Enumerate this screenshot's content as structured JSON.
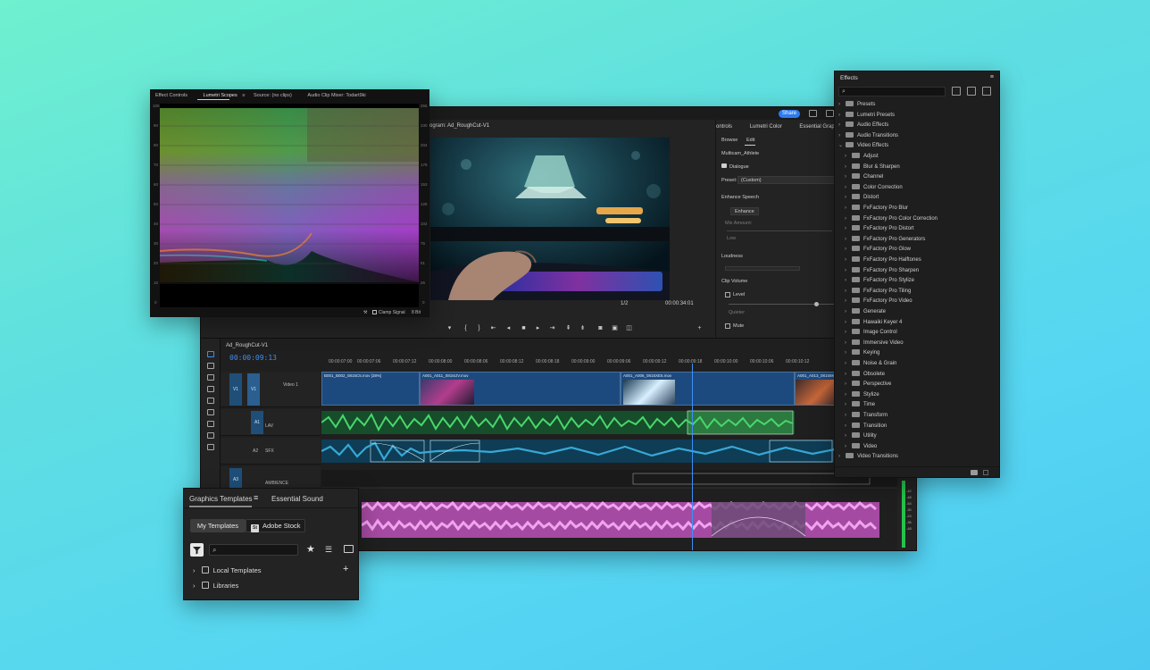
{
  "main": {
    "share_label": "Share",
    "program_tab": "Program: Ad_RoughCut-V1",
    "monitor_zoom": "1/2",
    "monitor_timecode": "00:00:34:01",
    "essential_sound": {
      "tabs": [
        "ontrols",
        "Lumetri Color",
        "Essential Graphics"
      ],
      "browse": "Browse",
      "edit": "Edit",
      "clip_name": "Multicam_Athlete",
      "type": "Dialogue",
      "preset_label": "Preset:",
      "preset_value": "(Custom)",
      "enhance_speech": "Enhance Speech",
      "enhance_button": "Enhance",
      "mix_amount": "Mix Amount:",
      "low": "Low",
      "loudness": "Loudness",
      "clip_volume": "Clip Volume",
      "level": "Level",
      "quieter": "Quieter",
      "mute": "Mute"
    }
  },
  "timeline": {
    "sequence_tab": "Ad_RoughCut-V1",
    "timecode": "00:00:09:13",
    "ruler": [
      "00:00:07:00",
      "00:00:07:06",
      "00:00:07:12",
      "00:00:08:00",
      "00:00:08:06",
      "00:00:08:12",
      "00:00:08:18",
      "00:00:09:00",
      "00:00:09:06",
      "00:00:09:12",
      "00:00:09:18",
      "00:00:10:00",
      "00:00:10:06",
      "00:00:10:12"
    ],
    "tracks": {
      "v1": {
        "badge": "V1",
        "target": "V1",
        "name": "Video 1"
      },
      "a1": {
        "badge": "A1",
        "name": "LAV"
      },
      "a2": {
        "badge": "A2",
        "name": "SFX"
      },
      "a3": {
        "badge": "A3",
        "name": "AMBIENCE"
      }
    },
    "clips": {
      "v1": [
        "B001_B002_0815C5.mov [38%]",
        "A001_A011_0815IJV.mov",
        "A001_A006_0815XE5.mov",
        "A001_A013_08158K.m"
      ]
    },
    "meter_ticks": [
      "-42",
      "-48",
      "-54",
      "-30",
      "-24",
      "-36",
      "-48"
    ]
  },
  "scopes": {
    "tabs": [
      "Effect Controls",
      "Lumetri Scopes",
      "Source: (no clips)",
      "Audio Clip Mixer: Todart9ki"
    ],
    "left_ticks": [
      "100",
      "90",
      "80",
      "70",
      "60",
      "50",
      "40",
      "30",
      "20",
      "10",
      "0"
    ],
    "right_ticks": [
      "255",
      "230",
      "204",
      "178",
      "153",
      "128",
      "102",
      "76",
      "51",
      "26",
      "0"
    ],
    "clamp_signal": "Clamp Signal",
    "bit_depth": "8 Bit"
  },
  "effects": {
    "title": "Effects",
    "items": [
      {
        "label": "Presets",
        "level": 0,
        "open": false
      },
      {
        "label": "Lumetri Presets",
        "level": 0,
        "open": false
      },
      {
        "label": "Audio Effects",
        "level": 0,
        "open": false
      },
      {
        "label": "Audio Transitions",
        "level": 0,
        "open": false
      },
      {
        "label": "Video Effects",
        "level": 0,
        "open": true
      },
      {
        "label": "Adjust",
        "level": 1,
        "open": false
      },
      {
        "label": "Blur & Sharpen",
        "level": 1,
        "open": false
      },
      {
        "label": "Channel",
        "level": 1,
        "open": false
      },
      {
        "label": "Color Correction",
        "level": 1,
        "open": false
      },
      {
        "label": "Distort",
        "level": 1,
        "open": false
      },
      {
        "label": "FxFactory Pro Blur",
        "level": 1,
        "open": false
      },
      {
        "label": "FxFactory Pro Color Correction",
        "level": 1,
        "open": false
      },
      {
        "label": "FxFactory Pro Distort",
        "level": 1,
        "open": false
      },
      {
        "label": "FxFactory Pro Generators",
        "level": 1,
        "open": false
      },
      {
        "label": "FxFactory Pro Glow",
        "level": 1,
        "open": false
      },
      {
        "label": "FxFactory Pro Halftones",
        "level": 1,
        "open": false
      },
      {
        "label": "FxFactory Pro Sharpen",
        "level": 1,
        "open": false
      },
      {
        "label": "FxFactory Pro Stylize",
        "level": 1,
        "open": false
      },
      {
        "label": "FxFactory Pro Tiling",
        "level": 1,
        "open": false
      },
      {
        "label": "FxFactory Pro Video",
        "level": 1,
        "open": false
      },
      {
        "label": "Generate",
        "level": 1,
        "open": false
      },
      {
        "label": "Hawaiki Keyer 4",
        "level": 1,
        "open": false
      },
      {
        "label": "Image Control",
        "level": 1,
        "open": false
      },
      {
        "label": "Immersive Video",
        "level": 1,
        "open": false
      },
      {
        "label": "Keying",
        "level": 1,
        "open": false
      },
      {
        "label": "Noise & Grain",
        "level": 1,
        "open": false
      },
      {
        "label": "Obsolete",
        "level": 1,
        "open": false
      },
      {
        "label": "Perspective",
        "level": 1,
        "open": false
      },
      {
        "label": "Stylize",
        "level": 1,
        "open": false
      },
      {
        "label": "Time",
        "level": 1,
        "open": false
      },
      {
        "label": "Transform",
        "level": 1,
        "open": false
      },
      {
        "label": "Transition",
        "level": 1,
        "open": false
      },
      {
        "label": "Utility",
        "level": 1,
        "open": false
      },
      {
        "label": "Video",
        "level": 1,
        "open": false
      },
      {
        "label": "Video Transitions",
        "level": 0,
        "open": false
      }
    ]
  },
  "graphics_templates": {
    "tab_active": "Graphics Templates",
    "tab_other": "Essential Sound",
    "my_templates": "My Templates",
    "stock_badge": "St",
    "adobe_stock": "Adobe Stock",
    "rows": [
      "Local Templates",
      "Libraries"
    ]
  },
  "colors": {
    "accent": "#2d7cf0",
    "timecode_blue": "#3f8ef5",
    "video_track": "#1d4a7e",
    "audio_green": "#2fa84f",
    "audio_teal": "#1f8cb0",
    "audio_pink": "#d56fd0"
  }
}
